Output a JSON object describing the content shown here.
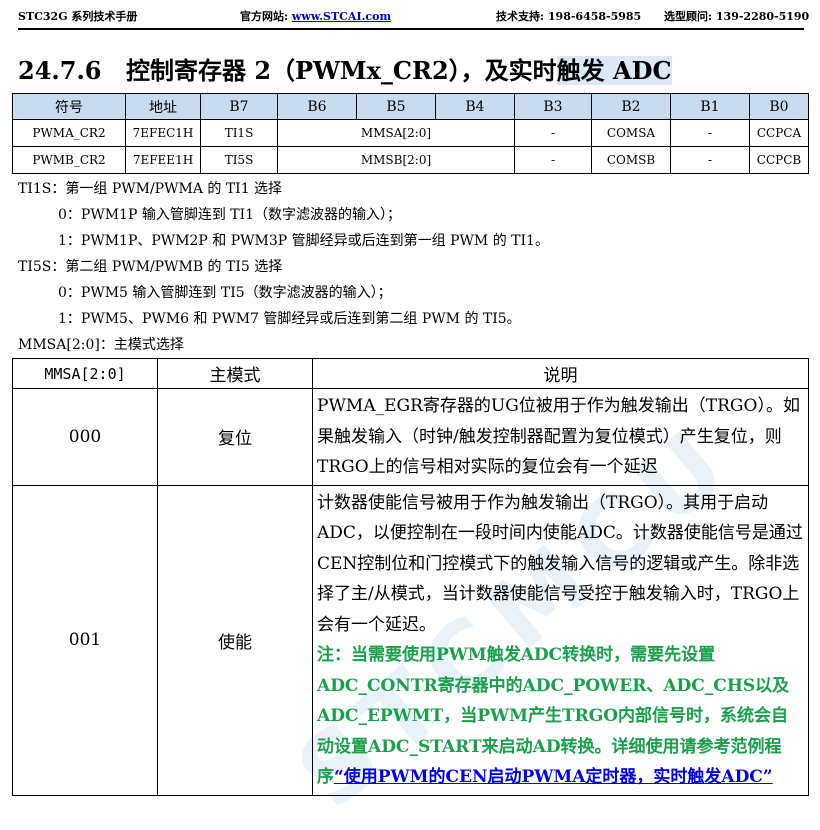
{
  "header": {
    "manual": "STC32G 系列技术手册",
    "site_label": "官方网站:",
    "site_link": "www.STCAI.com",
    "support": "技术支持: 198-6458-5985",
    "sales": "选型顾问: 139-2280-5190"
  },
  "section": {
    "number": "24.7.6",
    "title_plain": "控制寄存器 2（PWMx_CR2），及实时",
    "title_highlight": "触发 ADC"
  },
  "reg_table": {
    "headers": [
      "符号",
      "地址",
      "B7",
      "B6",
      "B5",
      "B4",
      "B3",
      "B2",
      "B1",
      "B0"
    ],
    "rows": [
      {
        "symbol": "PWMA_CR2",
        "address": "7EFEC1H",
        "b7": "TI1S",
        "b6_b4": "MMSA[2:0]",
        "b3": "-",
        "b2": "COMSA",
        "b1": "-",
        "b0": "CCPCA"
      },
      {
        "symbol": "PWMB_CR2",
        "address": "7EFEE1H",
        "b7": "TI5S",
        "b6_b4": "MMSB[2:0]",
        "b3": "-",
        "b2": "COMSB",
        "b1": "-",
        "b0": "CCPCB"
      }
    ]
  },
  "descriptions": [
    "TI1S：第一组 PWM/PWMA 的 TI1 选择",
    "0：PWM1P 输入管脚连到 TI1（数字滤波器的输入）；",
    "1：PWM1P、PWM2P 和 PWM3P 管脚经异或后连到第一组 PWM 的 TI1。",
    "TI5S：第二组 PWM/PWMB 的 TI5 选择",
    "0：PWM5 输入管脚连到 TI5（数字滤波器的输入）；",
    "1：PWM5、PWM6 和 PWM7 管脚经异或后连到第二组 PWM 的 TI5。",
    "MMSA[2:0]：主模式选择"
  ],
  "mode_table": {
    "headers": [
      "MMSA[2:0]",
      "主模式",
      "说明"
    ],
    "rows": [
      {
        "value": "000",
        "mode": "复位",
        "text": "PWMA_EGR寄存器的UG位被用于作为触发输出（TRGO）。如果触发输入（时钟/触发控制器配置为复位模式）产生复位，则TRGO上的信号相对实际的复位会有一个延迟"
      },
      {
        "value": "001",
        "mode": "使能",
        "text": "计数器使能信号被用于作为触发输出（TRGO）。其用于启动ADC，以便控制在一段时间内使能ADC。计数器使能信号是通过CEN控制位和门控模式下的触发输入信号的逻辑或产生。除非选择了主/从模式，当计数器使能信号受控于触发输入时，TRGO上会有一个延迟。",
        "note": "注：当需要使用PWM触发ADC转换时，需要先设置ADC_CONTR寄存器中的ADC_POWER、ADC_CHS以及ADC_EPWMT，当PWM产生TRGO内部信号时，系统会自动设置ADC_START来启动AD转换。详细使用请参考范例程序",
        "link": "“使用PWM的CEN启动PWMA定时器，实时触发ADC”"
      }
    ]
  }
}
